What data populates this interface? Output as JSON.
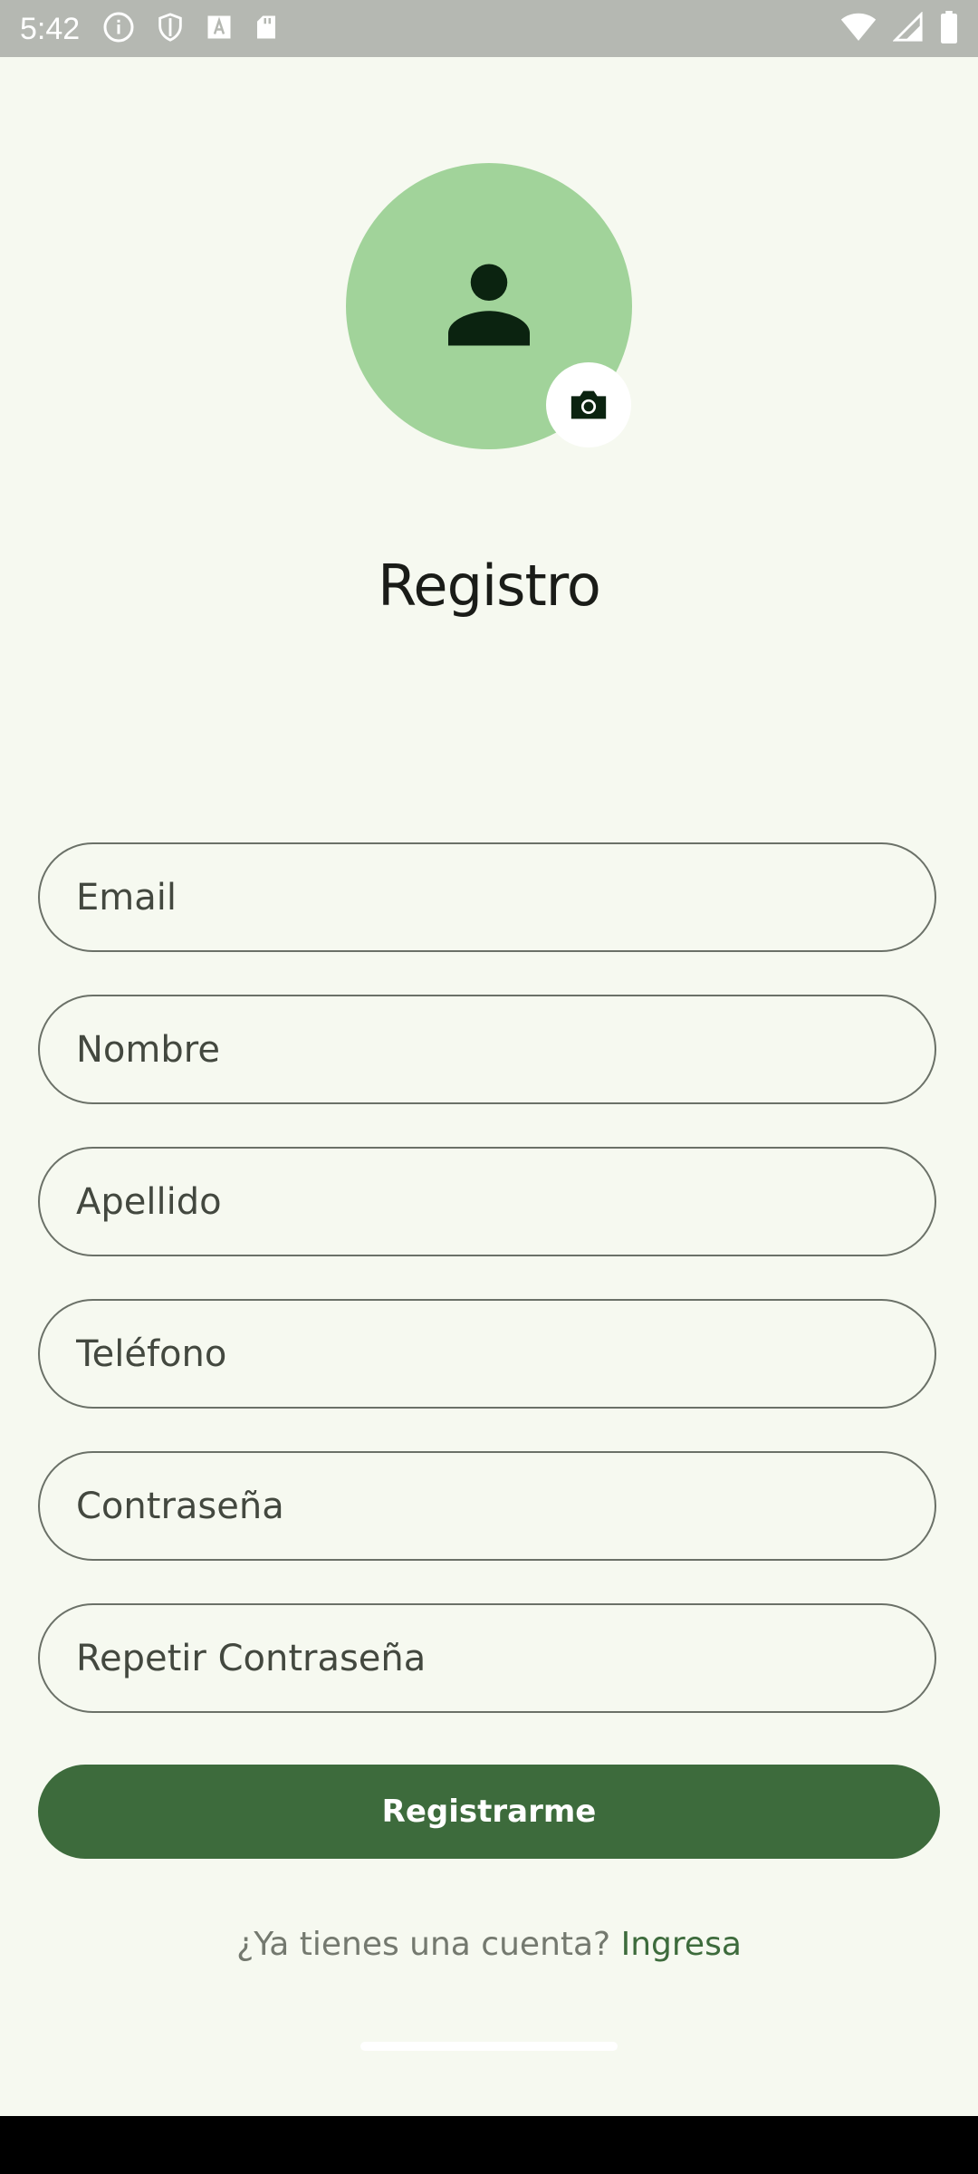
{
  "status_bar": {
    "time": "5:42",
    "left_icons": [
      "info-icon",
      "shield-icon",
      "font-icon",
      "sd-card-icon"
    ],
    "right_icons": [
      "wifi-icon",
      "signal-icon",
      "battery-icon"
    ]
  },
  "avatar": {
    "icon": "person-icon",
    "camera_icon": "camera-icon",
    "colors": {
      "circle": "#a1d39a",
      "icon": "#0b2310"
    }
  },
  "title": "Registro",
  "form": {
    "email": {
      "placeholder": "Email",
      "value": ""
    },
    "first_name": {
      "placeholder": "Nombre",
      "value": ""
    },
    "last_name": {
      "placeholder": "Apellido",
      "value": ""
    },
    "phone": {
      "placeholder": "Teléfono",
      "value": ""
    },
    "password": {
      "placeholder": "Contraseña",
      "value": ""
    },
    "repeat_password": {
      "placeholder": "Repetir Contraseña",
      "value": ""
    }
  },
  "register_button": {
    "label": "Registrarme"
  },
  "login_prompt": {
    "text": "¿Ya tienes una cuenta?",
    "link": "Ingresa"
  },
  "colors": {
    "background": "#f6f9f0",
    "primary": "#3d6b3c",
    "outline": "#6b7168"
  }
}
